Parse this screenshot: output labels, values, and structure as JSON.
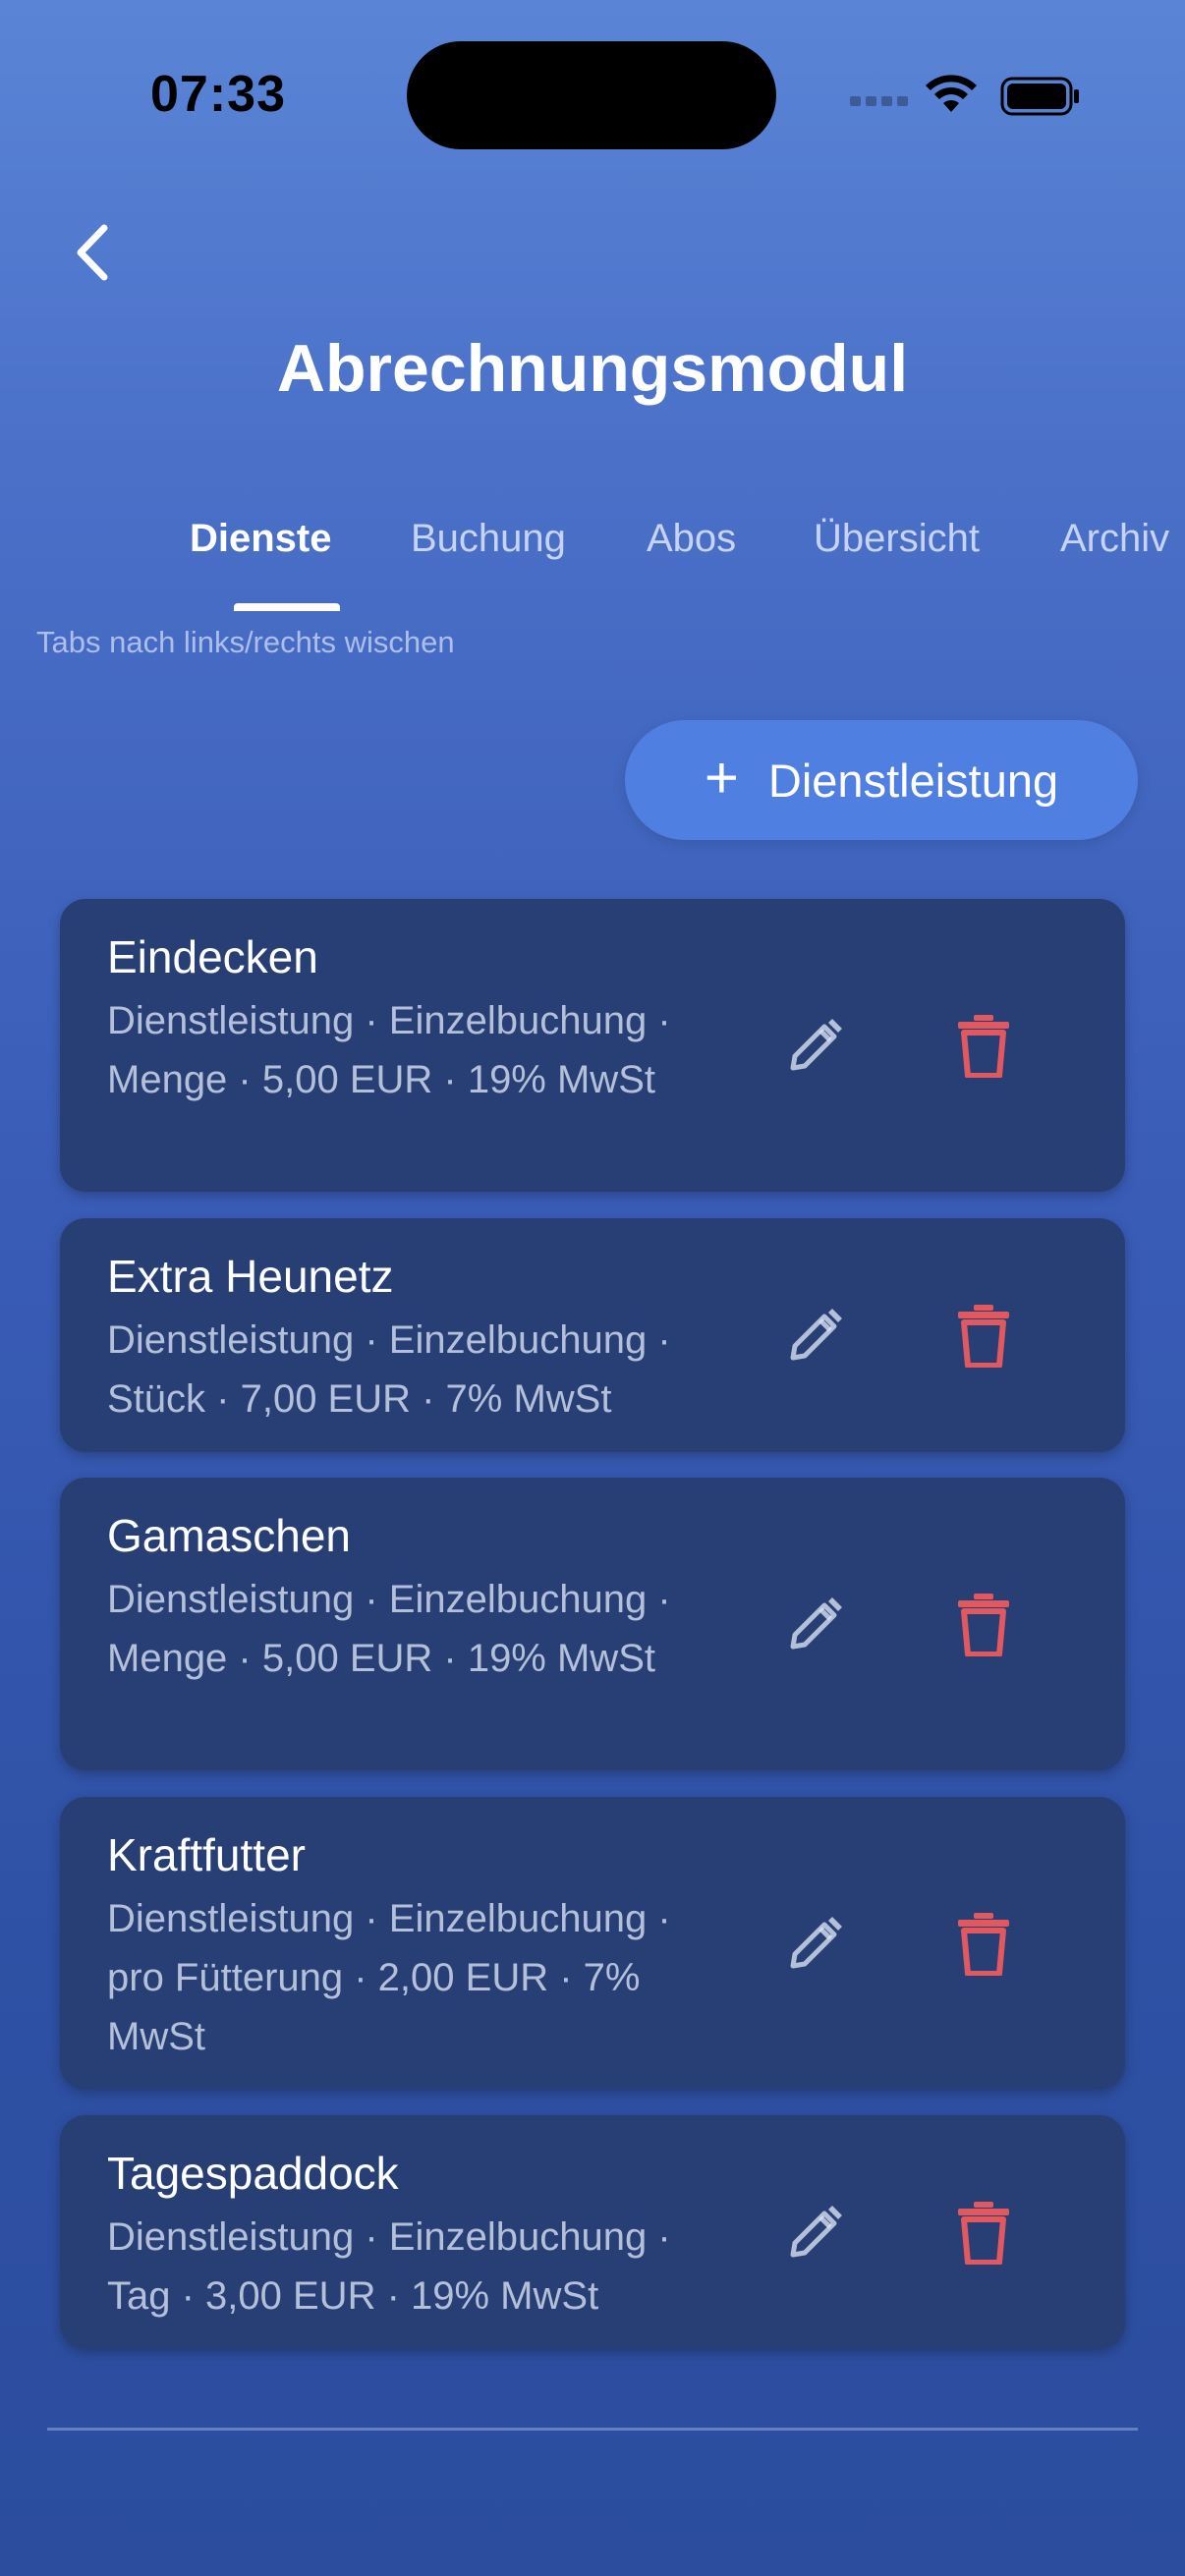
{
  "status": {
    "time": "07:33"
  },
  "header": {
    "title": "Abrechnungsmodul"
  },
  "tabs": [
    {
      "label": "Dienste",
      "active": true
    },
    {
      "label": "Buchung",
      "active": false
    },
    {
      "label": "Abos",
      "active": false
    },
    {
      "label": "Übersicht",
      "active": false
    },
    {
      "label": "Archiv",
      "active": false
    }
  ],
  "hint": "Tabs nach links/rechts wischen",
  "add_button": {
    "icon": "+",
    "label": "Dienstleistung"
  },
  "services": [
    {
      "name": "Eindecken",
      "desc": "Dienstleistung · Einzelbuchung · Menge · 5,00 EUR · 19% MwSt"
    },
    {
      "name": "Extra Heunetz",
      "desc": "Dienstleistung · Einzelbuchung · Stück · 7,00 EUR · 7% MwSt"
    },
    {
      "name": "Gamaschen",
      "desc": "Dienstleistung · Einzelbuchung · Menge · 5,00 EUR · 19% MwSt"
    },
    {
      "name": "Kraftfutter",
      "desc": "Dienstleistung · Einzelbuchung · pro Fütterung · 2,00 EUR · 7% MwSt"
    },
    {
      "name": "Tagespaddock",
      "desc": "Dienstleistung · Einzelbuchung · Tag · 3,00 EUR · 19% MwSt"
    }
  ],
  "colors": {
    "accent": "#4f7fe0",
    "card": "#273f75",
    "delete": "#e2585f"
  }
}
